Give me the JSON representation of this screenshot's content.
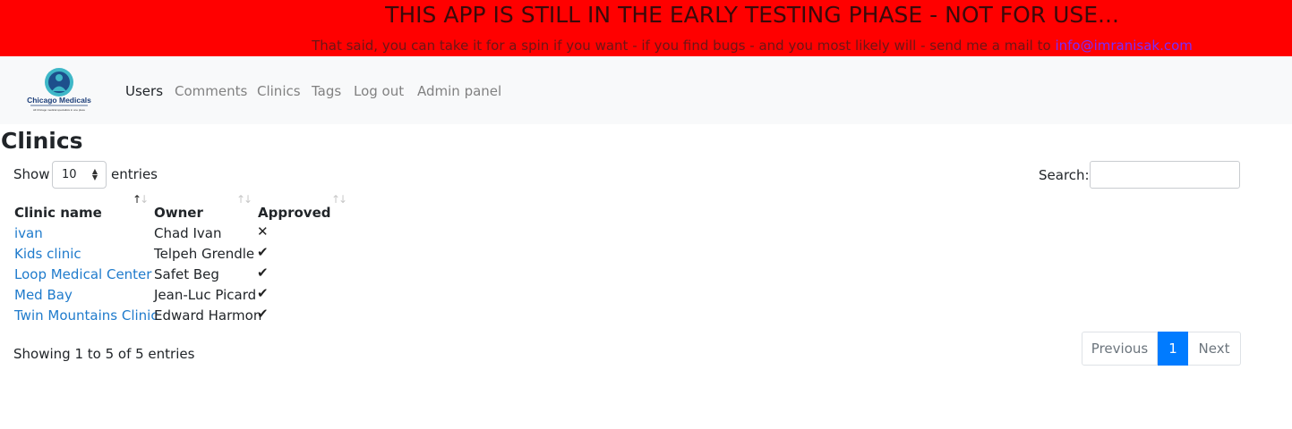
{
  "banner": {
    "title": "THIS APP IS STILL IN THE EARLY TESTING PHASE - NOT FOR USE...",
    "message": "That said, you can take it for a spin if you want - if you find bugs - and you most likely will - send me a mail to ",
    "email": "info@imranisak.com",
    "background_color": "#ff0000"
  },
  "navbar": {
    "logo": {
      "name": "Chicago Medicals",
      "tagline": "All Chicago medical specialists in one place"
    },
    "links": [
      "Users",
      "Comments",
      "Clinics",
      "Tags",
      "Log out",
      "Admin panel"
    ]
  },
  "page": {
    "title": "Clinics"
  },
  "table_controls": {
    "show_label": "Show",
    "page_length": "10",
    "entries_label": "entries",
    "search_label": "Search:",
    "search_value": ""
  },
  "table": {
    "headers": [
      "Clinic name",
      "Owner",
      "Approved"
    ],
    "rows": [
      {
        "clinic": "ivan",
        "owner": "Chad Ivan",
        "approved": "✕"
      },
      {
        "clinic": "Kids clinic",
        "owner": "Telpeh Grendle",
        "approved": "✔"
      },
      {
        "clinic": "Loop Medical Center",
        "owner": "Safet Beg",
        "approved": "✔"
      },
      {
        "clinic": "Med Bay",
        "owner": "Jean-Luc Picard",
        "approved": "✔"
      },
      {
        "clinic": "Twin Mountains Clinic",
        "owner": "Edward Harmon",
        "approved": "✔"
      }
    ]
  },
  "footer": {
    "info": "Showing 1 to 5 of 5 entries",
    "pagination": {
      "previous": "Previous",
      "current": "1",
      "next": "Next"
    }
  },
  "colors": {
    "accent": "#007bff",
    "link": "#1f7bcc"
  }
}
